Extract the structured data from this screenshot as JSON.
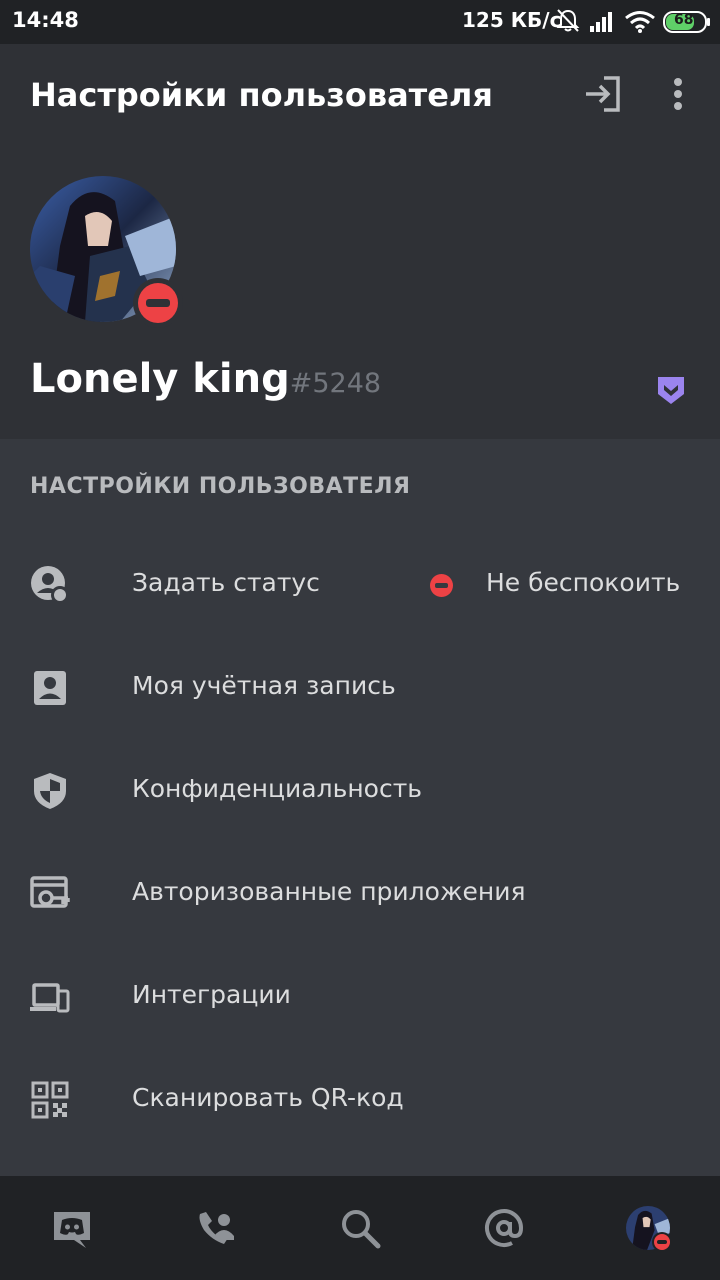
{
  "statusbar": {
    "time": "14:48",
    "speed": "125 КБ/с",
    "battery": "68",
    "icons": [
      "muted-bell-icon",
      "signal-icon",
      "wifi-icon",
      "battery-icon"
    ]
  },
  "header": {
    "title": "Настройки пользователя",
    "actions": [
      "logout-icon",
      "more-vertical-icon"
    ]
  },
  "profile": {
    "username": "Lonely king",
    "discriminator": "#5248",
    "status": "dnd",
    "badge_icon": "nitro-badge-icon"
  },
  "section": {
    "label": "НАСТРОЙКИ ПОЛЬЗОВАТЕЛЯ"
  },
  "menu": [
    {
      "label": "Задать статус",
      "icon": "status-icon",
      "value": "Не беспокоить"
    },
    {
      "label": "Моя учётная запись",
      "icon": "account-icon"
    },
    {
      "label": "Конфиденциальность",
      "icon": "shield-icon"
    },
    {
      "label": "Авторизованные приложения",
      "icon": "authorized-apps-icon"
    },
    {
      "label": "Интеграции",
      "icon": "devices-icon"
    },
    {
      "label": "Сканировать QR-код",
      "icon": "qr-code-icon"
    }
  ],
  "bottom_nav": [
    "discord-home-icon",
    "friends-icon",
    "search-icon",
    "mentions-icon",
    "profile-avatar"
  ],
  "colors": {
    "background": "#36393f",
    "header": "#2f3136",
    "nav": "#202225",
    "dnd": "#ed4245",
    "nitro": "#9b84ee"
  }
}
